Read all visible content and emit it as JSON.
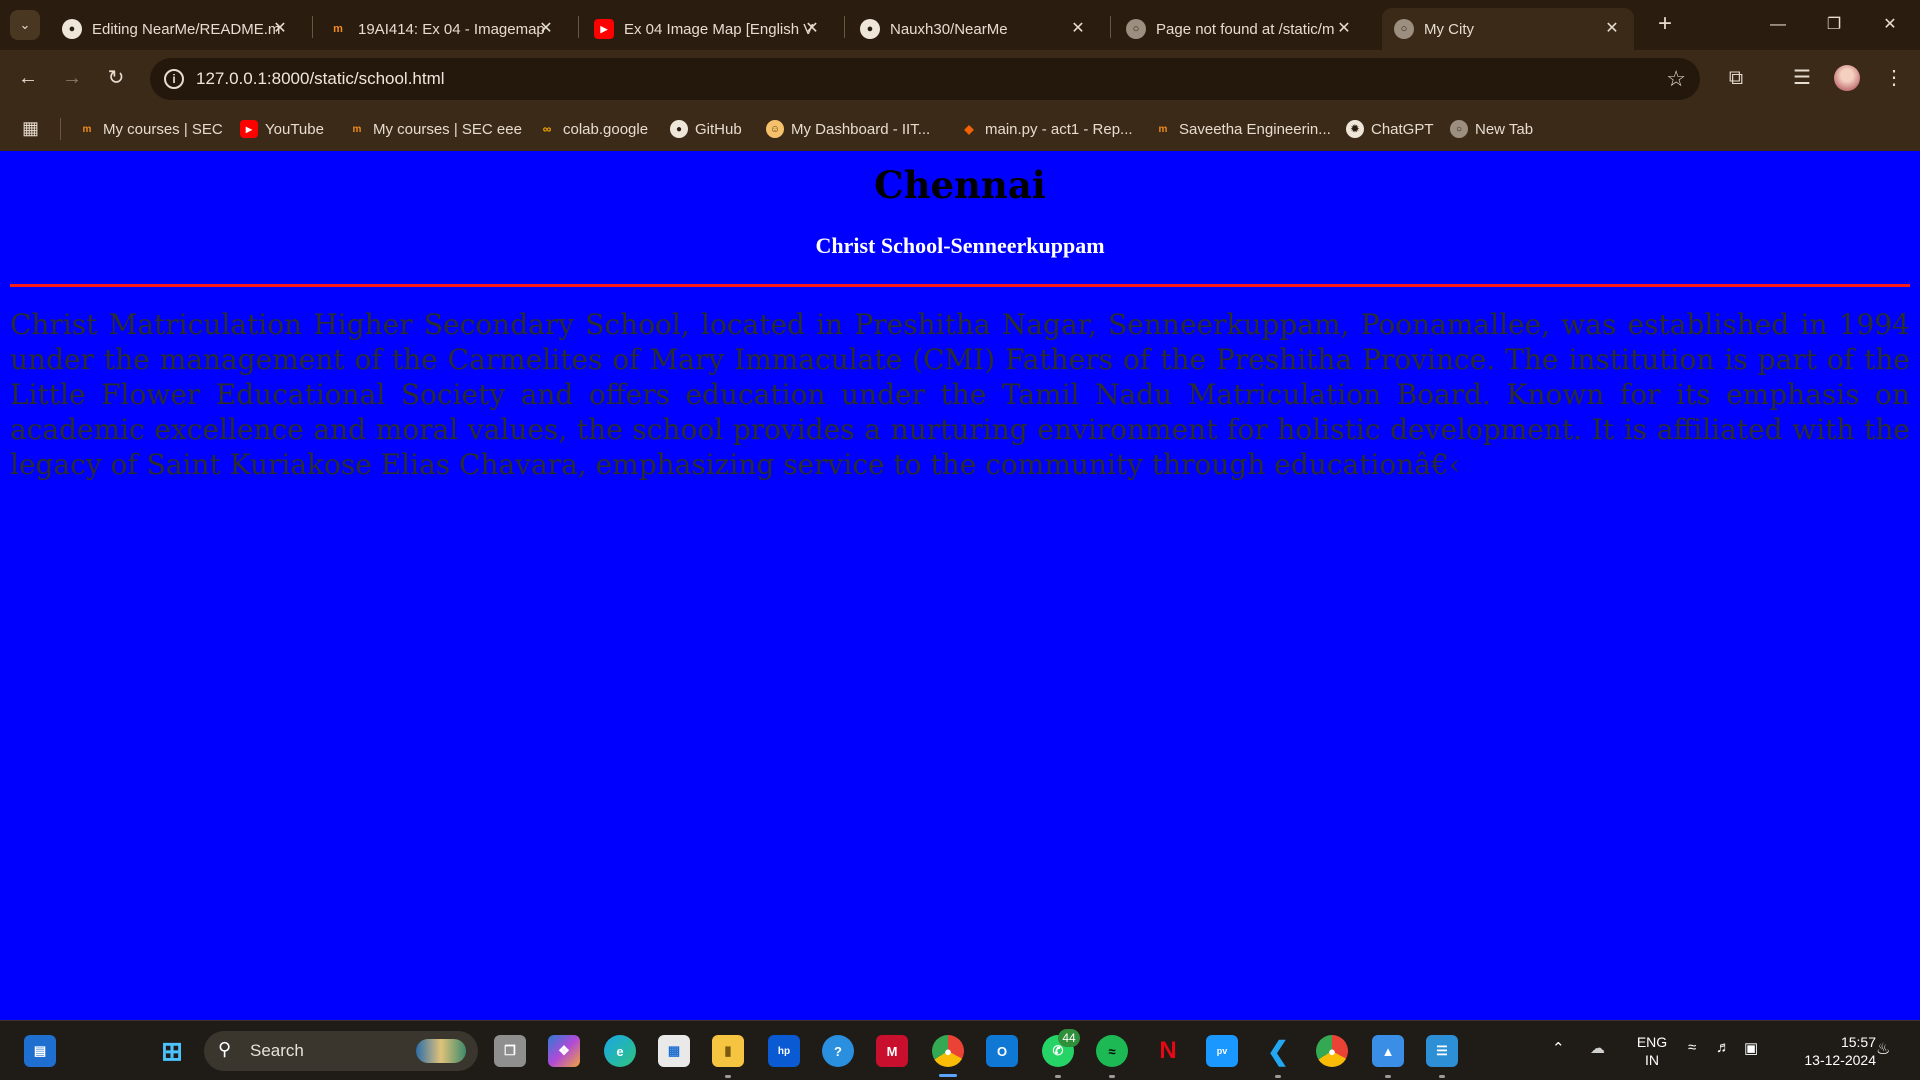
{
  "browser": {
    "tabs": [
      {
        "title": "Editing NearMe/README.m",
        "icon": "github-icon"
      },
      {
        "title": "19AI414: Ex 04 - Imagemap",
        "icon": "moodle-icon"
      },
      {
        "title": "Ex 04 Image Map [English V",
        "icon": "youtube-icon"
      },
      {
        "title": "Nauxh30/NearMe",
        "icon": "github-icon"
      },
      {
        "title": "Page not found at /static/m",
        "icon": "globe-icon"
      },
      {
        "title": "My City",
        "icon": "globe-icon"
      }
    ],
    "active_tab_index": 5,
    "new_tab_label": "+",
    "url": "127.0.0.1:8000/static/school.html",
    "bookmarks": [
      {
        "label": "My courses | SEC",
        "icon": "moodle-icon"
      },
      {
        "label": "YouTube",
        "icon": "youtube-icon"
      },
      {
        "label": "My courses | SEC eee",
        "icon": "moodle-icon"
      },
      {
        "label": "colab.google",
        "icon": "colab-icon"
      },
      {
        "label": "GitHub",
        "icon": "github-icon"
      },
      {
        "label": "My Dashboard - IIT...",
        "icon": "dashboard-icon"
      },
      {
        "label": "main.py - act1 - Rep...",
        "icon": "replit-icon"
      },
      {
        "label": "Saveetha Engineerin...",
        "icon": "moodle-icon"
      },
      {
        "label": "ChatGPT",
        "icon": "chatgpt-icon"
      },
      {
        "label": "New Tab",
        "icon": "globe-icon"
      }
    ]
  },
  "page": {
    "city": "Chennai",
    "school": "Christ School-Senneerkuppam",
    "description": "Christ Matriculation Higher Secondary School, located in Preshitha Nagar, Senneerkuppam, Poonamallee, was established in 1994 under the management of the Carmelites of Mary Immaculate (CMI) Fathers of the Preshitha Province. The institution is part of the Little Flower Educational Society and offers education under the Tamil Nadu Matriculation Board. Known for its emphasis on academic excellence and moral values, the school provides a nurturing environment for holistic development. It is affiliated with the legacy of Saint Kuriakose Elias Chavara, emphasizing service to the community through educationâ€‹"
  },
  "taskbar": {
    "search_label": "Search",
    "whatsapp_badge": "44",
    "language": "ENG",
    "region": "IN",
    "time": "15:57",
    "date": "13-12-2024"
  },
  "colors": {
    "page_background": "#0000ff",
    "rule": "#ff1a1a",
    "chrome": "#3c2a18"
  }
}
